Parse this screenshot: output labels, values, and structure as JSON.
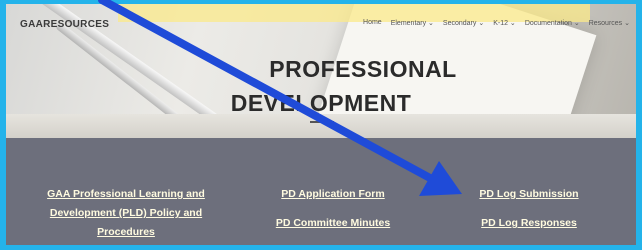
{
  "site": {
    "name": "GAARESOURCES"
  },
  "nav": [
    {
      "label": "Home"
    },
    {
      "label": "Elementary ⌄"
    },
    {
      "label": "Secondary ⌄"
    },
    {
      "label": "K-12 ⌄"
    },
    {
      "label": "Documentation ⌄"
    },
    {
      "label": "Resources ⌄"
    }
  ],
  "hero": {
    "title_line1": "PROFESSIONAL",
    "title_line2": "DEVELOPMENT"
  },
  "links": {
    "policy": "GAA Professional Learning and Development (PLD) Policy and Procedures",
    "application_form": "PD Application Form",
    "committee_minutes": "PD Committee Minutes",
    "log_submission": "PD Log Submission",
    "log_responses": "PD Log Responses"
  },
  "colors": {
    "border": "#24b3ea",
    "band": "#6d6f7c",
    "link_text": "#fffbe0",
    "annotation_arrow": "#1f4bd8",
    "highlight": "#fbe98a"
  }
}
